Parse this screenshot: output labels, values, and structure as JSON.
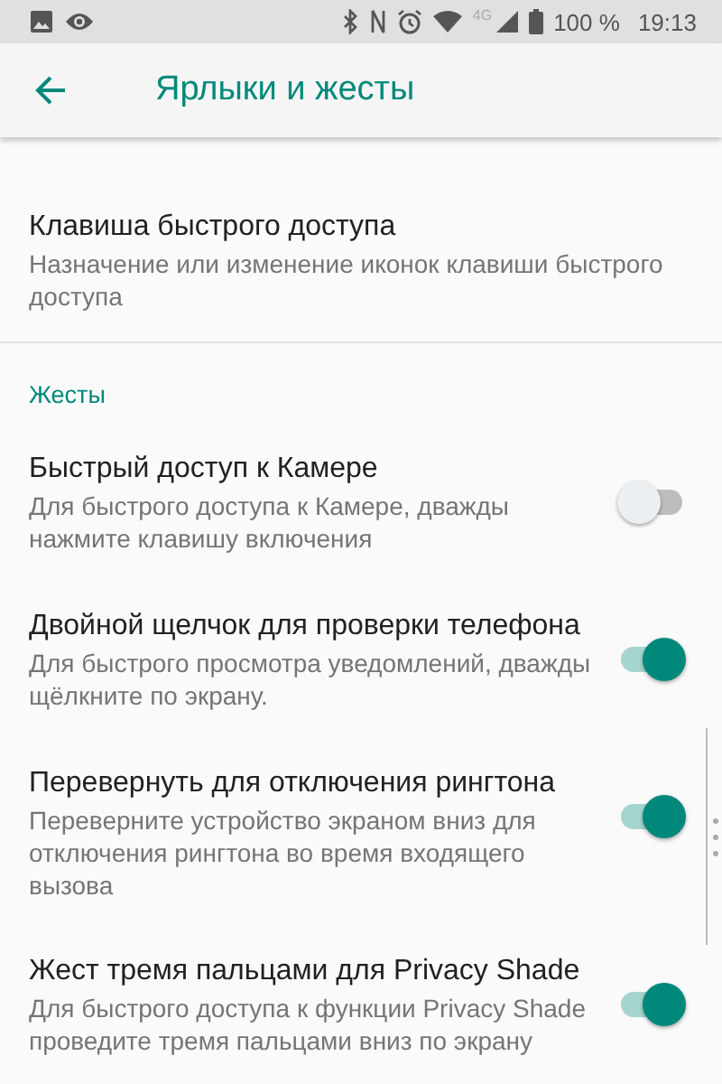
{
  "status_bar": {
    "network": "4G",
    "battery": "100 %",
    "time": "19:13"
  },
  "toolbar": {
    "title": "Ярлыки и жесты"
  },
  "items": [
    {
      "title": "Клавиша быстрого доступа",
      "summary": "Назначение или изменение иконок клавиши быстрого доступа"
    }
  ],
  "section": {
    "title": "Жесты",
    "items": [
      {
        "title": "Быстрый доступ к Камере",
        "summary": "Для быстрого доступа к Камере, дважды нажмите клавишу включения",
        "on": false
      },
      {
        "title": "Двойной щелчок для проверки телефона",
        "summary": "Для быстрого просмотра уведомлений, дважды щёлкните по экрану.",
        "on": true
      },
      {
        "title": "Перевернуть для отключения рингтона",
        "summary": "Переверните устройство экраном вниз для отключения рингтона во время входящего вызова",
        "on": true
      },
      {
        "title": "Жест тремя пальцами для Privacy Shade",
        "summary": "Для быстрого доступа к функции Privacy Shade проведите тремя пальцами вниз по экрану",
        "on": true
      }
    ]
  }
}
